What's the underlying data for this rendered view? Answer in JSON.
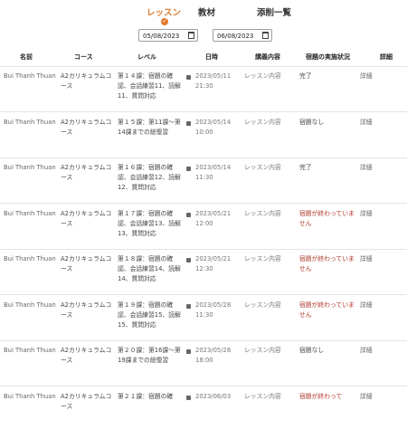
{
  "tabs": [
    {
      "label": "レッスン",
      "active": true
    },
    {
      "label": "教材",
      "active": false
    },
    {
      "label": "添削一覧",
      "active": false
    }
  ],
  "filters": {
    "from_date": "05/08/2023",
    "to_date": "06/08/2023"
  },
  "columns": [
    "名前",
    "コース",
    "レベル",
    "日時",
    "講義内容",
    "宿題の実施状況",
    "詳細"
  ],
  "colors": {
    "accent": "#e07b2e",
    "warning": "#b03a2e"
  },
  "rows": [
    {
      "name": "Bui Thanh Thuan",
      "course": "A2カリキュラムコース",
      "level": "第１４課：宿題の確認、会話練習11、読解11、質問対応",
      "date": "2023/05/11",
      "time": "21:30",
      "content": "レッスン内容",
      "status": "完了",
      "status_type": "done",
      "detail": "詳細"
    },
    {
      "name": "Bui Thanh Thuan",
      "course": "A2カリキュラムコース",
      "level": "第１５課：第11課～第14課までの総復習",
      "date": "2023/05/14",
      "time": "10:00",
      "content": "レッスン内容",
      "status": "宿題なし",
      "status_type": "none",
      "detail": "詳細"
    },
    {
      "name": "Bui Thanh Thuan",
      "course": "A2カリキュラムコース",
      "level": "第１６課：宿題の確認、会話練習12、読解12、質問対応",
      "date": "2023/05/14",
      "time": "11:30",
      "content": "レッスン内容",
      "status": "完了",
      "status_type": "done",
      "detail": "詳細"
    },
    {
      "name": "Bui Thanh Thuan",
      "course": "A2カリキュラムコース",
      "level": "第１７課：宿題の確認、会話練習13、読解13、質問対応",
      "date": "2023/05/21",
      "time": "12:00",
      "content": "レッスン内容",
      "status": "宿題が終わっていません",
      "status_type": "pending",
      "detail": "詳細"
    },
    {
      "name": "Bui Thanh Thuan",
      "course": "A2カリキュラムコース",
      "level": "第１８課：宿題の確認、会話練習14、読解14、質問対応",
      "date": "2023/05/21",
      "time": "12:30",
      "content": "レッスン内容",
      "status": "宿題が終わっていません",
      "status_type": "pending",
      "detail": "詳細"
    },
    {
      "name": "Bui Thanh Thuan",
      "course": "A2カリキュラムコース",
      "level": "第１９課：宿題の確認、会話練習15、読解15、質問対応",
      "date": "2023/05/28",
      "time": "11:30",
      "content": "レッスン内容",
      "status": "宿題が終わっていません",
      "status_type": "pending",
      "detail": "詳細"
    },
    {
      "name": "Bui Thanh Thuan",
      "course": "A2カリキュラムコース",
      "level": "第２０課：第16課～第19課までの総復習",
      "date": "2023/05/28",
      "time": "18:00",
      "content": "レッスン内容",
      "status": "宿題なし",
      "status_type": "none",
      "detail": "詳細"
    },
    {
      "name": "Bui Thanh Thuan",
      "course": "A2カリキュラムコース",
      "level": "第２１課：宿題の確",
      "date": "2023/06/03",
      "time": "",
      "content": "レッスン内容",
      "status": "宿題が終わって",
      "status_type": "pending",
      "detail": "詳細"
    }
  ]
}
